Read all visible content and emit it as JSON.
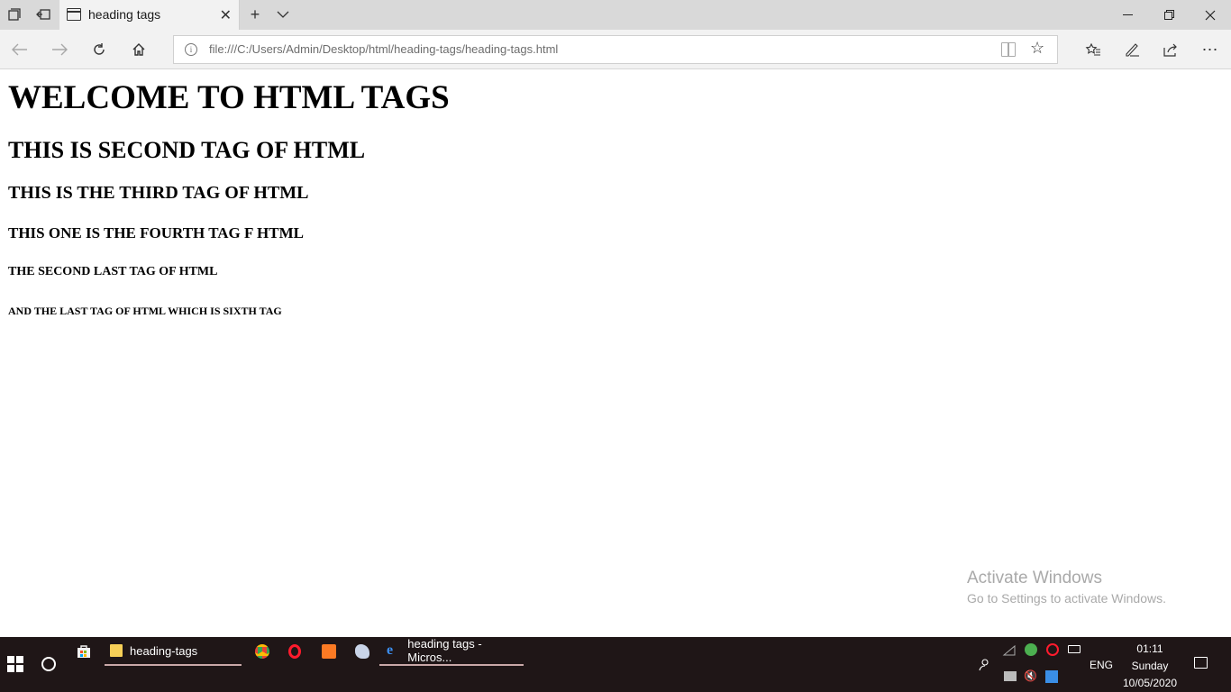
{
  "browser": {
    "tab_title": "heading tags",
    "url": "file:///C:/Users/Admin/Desktop/html/heading-tags/heading-tags.html"
  },
  "page": {
    "h1": "WELCOME TO HTML TAGS",
    "h2": "THIS IS SECOND TAG OF HTML",
    "h3": "THIS IS THE THIRD TAG OF HTML",
    "h4": "THIS ONE IS THE FOURTH TAG F HTML",
    "h5": "THE SECOND LAST TAG OF HTML",
    "h6": "AND THE LAST TAG OF HTML WHICH IS SIXTH TAG"
  },
  "watermark": {
    "title": "Activate Windows",
    "subtitle": "Go to Settings to activate Windows."
  },
  "taskbar": {
    "folder_label": "heading-tags",
    "edge_label": "heading tags - Micros...",
    "language": "ENG",
    "time": "01:11",
    "day": "Sunday",
    "date": "10/05/2020"
  }
}
